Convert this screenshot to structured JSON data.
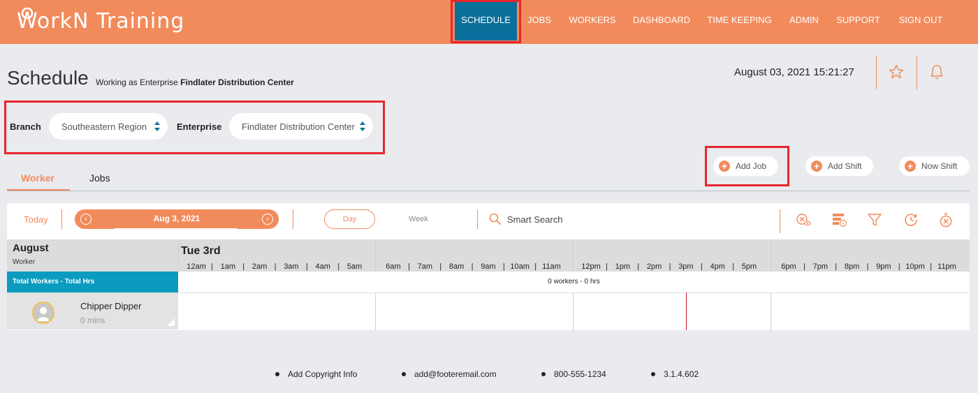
{
  "app": {
    "logo_text": "WorkN Training",
    "accent_color": "#f28b5c",
    "active_nav_color": "#0a6f9a"
  },
  "nav": {
    "items": [
      {
        "label": "SCHEDULE",
        "active": true
      },
      {
        "label": "JOBS"
      },
      {
        "label": "WORKERS"
      },
      {
        "label": "DASHBOARD"
      },
      {
        "label": "TIME KEEPING"
      },
      {
        "label": "ADMIN"
      },
      {
        "label": "SUPPORT"
      },
      {
        "label": "SIGN OUT"
      }
    ]
  },
  "page": {
    "title": "Schedule",
    "subtitle_prefix": "Working as Enterprise",
    "subtitle_enterprise": "Findlater Distribution Center",
    "datetime": "August 03, 2021 15:21:27"
  },
  "filters": {
    "branch_label": "Branch",
    "branch_value": "Southeastern Region",
    "enterprise_label": "Enterprise",
    "enterprise_value": "Findlater Distribution Center"
  },
  "tabs": [
    {
      "label": "Worker",
      "active": true
    },
    {
      "label": "Jobs"
    }
  ],
  "actions": {
    "add_job": "Add Job",
    "add_shift": "Add Shift",
    "now_shift": "Now Shift"
  },
  "toolbar": {
    "today": "Today",
    "date": "Aug 3, 2021",
    "view_day": "Day",
    "view_week": "Week",
    "search": "Smart Search"
  },
  "grid": {
    "month": "August",
    "row_header": "Worker",
    "day": "Tue 3rd",
    "hours": [
      "12am",
      "1am",
      "2am",
      "3am",
      "4am",
      "5am",
      "6am",
      "7am",
      "8am",
      "9am",
      "10am",
      "11am",
      "12pm",
      "1pm",
      "2pm",
      "3pm",
      "4pm",
      "5pm",
      "6pm",
      "7pm",
      "8pm",
      "9pm",
      "10pm",
      "11pm"
    ],
    "total_label": "Total Workers - Total Hrs",
    "total_value": "0 workers - 0 hrs",
    "workers": [
      {
        "name": "Chipper Dipper",
        "mins": "0 mins"
      }
    ]
  },
  "footer": {
    "copyright": "Add Copyright Info",
    "email": "add@footeremail.com",
    "phone": "800-555-1234",
    "version": "3.1.4.602"
  }
}
